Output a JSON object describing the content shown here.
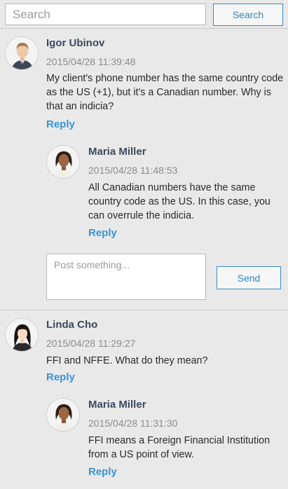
{
  "search": {
    "placeholder": "Search",
    "value": "",
    "button_label": "Search"
  },
  "threads": [
    {
      "comment": {
        "author": "Igor Ubinov",
        "timestamp": "2015/04/28 11:39:48",
        "text": "My client's phone number has the same country code as the US (+1), but it's a Canadian number. Why is that an indicia?",
        "reply_label": "Reply"
      },
      "reply": {
        "author": "Maria Miller",
        "timestamp": "2015/04/28 11:48:53",
        "text": "All Canadian numbers have the same country code as the US. In this case, you can overrule the indicia.",
        "reply_label": "Reply"
      }
    },
    {
      "comment": {
        "author": "Linda Cho",
        "timestamp": "2015/04/28 11:29:27",
        "text": "FFI and NFFE. What do they mean?",
        "reply_label": "Reply"
      },
      "reply": {
        "author": "Maria Miller",
        "timestamp": "2015/04/28 11:31:30",
        "text": "FFI means a Foreign Financial Institution from a US point of view.",
        "reply_label": "Reply"
      }
    }
  ],
  "post": {
    "placeholder": "Post something...",
    "value": "",
    "send_label": "Send"
  },
  "colors": {
    "accent": "#3a93d6",
    "author": "#3b4a5e",
    "background": "#e9e9e9"
  }
}
